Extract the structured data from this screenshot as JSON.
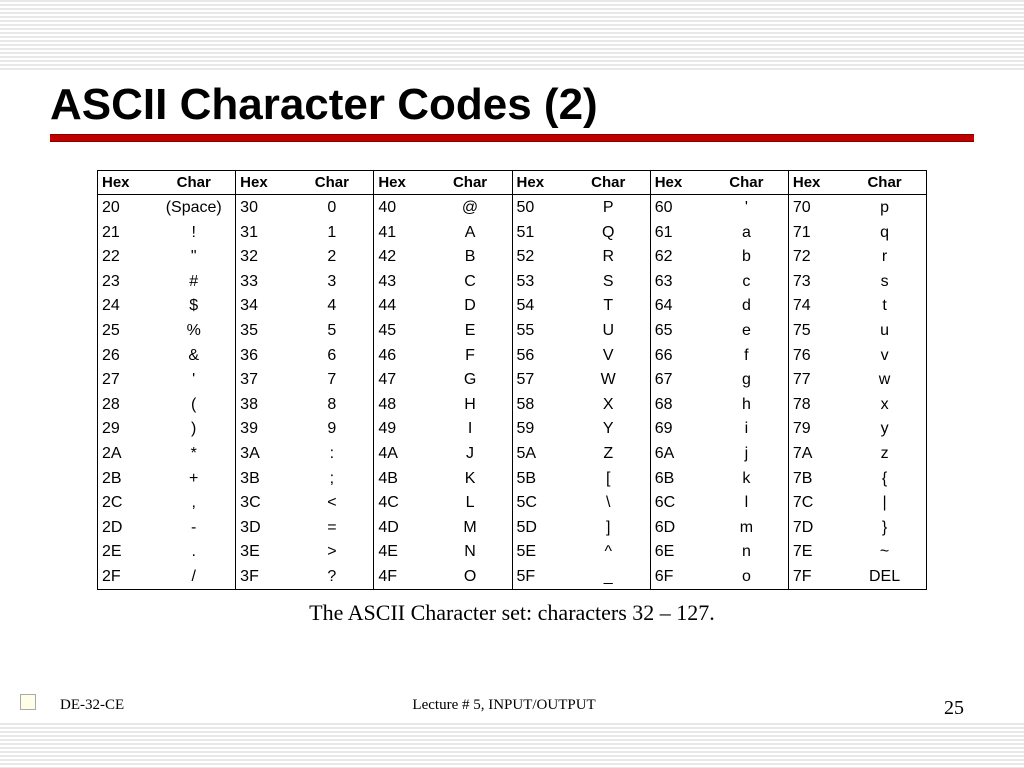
{
  "title": "ASCII Character Codes (2)",
  "headers": {
    "hex": "Hex",
    "char": "Char"
  },
  "columns": [
    [
      {
        "hex": "20",
        "char": "(Space)"
      },
      {
        "hex": "21",
        "char": "!"
      },
      {
        "hex": "22",
        "char": "\""
      },
      {
        "hex": "23",
        "char": "#"
      },
      {
        "hex": "24",
        "char": "$"
      },
      {
        "hex": "25",
        "char": "%"
      },
      {
        "hex": "26",
        "char": "&"
      },
      {
        "hex": "27",
        "char": "'"
      },
      {
        "hex": "28",
        "char": "("
      },
      {
        "hex": "29",
        "char": ")"
      },
      {
        "hex": "2A",
        "char": "*"
      },
      {
        "hex": "2B",
        "char": "+"
      },
      {
        "hex": "2C",
        "char": ","
      },
      {
        "hex": "2D",
        "char": "-"
      },
      {
        "hex": "2E",
        "char": "."
      },
      {
        "hex": "2F",
        "char": "/"
      }
    ],
    [
      {
        "hex": "30",
        "char": "0"
      },
      {
        "hex": "31",
        "char": "1"
      },
      {
        "hex": "32",
        "char": "2"
      },
      {
        "hex": "33",
        "char": "3"
      },
      {
        "hex": "34",
        "char": "4"
      },
      {
        "hex": "35",
        "char": "5"
      },
      {
        "hex": "36",
        "char": "6"
      },
      {
        "hex": "37",
        "char": "7"
      },
      {
        "hex": "38",
        "char": "8"
      },
      {
        "hex": "39",
        "char": "9"
      },
      {
        "hex": "3A",
        "char": ":"
      },
      {
        "hex": "3B",
        "char": ";"
      },
      {
        "hex": "3C",
        "char": "<"
      },
      {
        "hex": "3D",
        "char": "="
      },
      {
        "hex": "3E",
        "char": ">"
      },
      {
        "hex": "3F",
        "char": "?"
      }
    ],
    [
      {
        "hex": "40",
        "char": "@"
      },
      {
        "hex": "41",
        "char": "A"
      },
      {
        "hex": "42",
        "char": "B"
      },
      {
        "hex": "43",
        "char": "C"
      },
      {
        "hex": "44",
        "char": "D"
      },
      {
        "hex": "45",
        "char": "E"
      },
      {
        "hex": "46",
        "char": "F"
      },
      {
        "hex": "47",
        "char": "G"
      },
      {
        "hex": "48",
        "char": "H"
      },
      {
        "hex": "49",
        "char": "I"
      },
      {
        "hex": "4A",
        "char": "J"
      },
      {
        "hex": "4B",
        "char": "K"
      },
      {
        "hex": "4C",
        "char": "L"
      },
      {
        "hex": "4D",
        "char": "M"
      },
      {
        "hex": "4E",
        "char": "N"
      },
      {
        "hex": "4F",
        "char": "O"
      }
    ],
    [
      {
        "hex": "50",
        "char": "P"
      },
      {
        "hex": "51",
        "char": "Q"
      },
      {
        "hex": "52",
        "char": "R"
      },
      {
        "hex": "53",
        "char": "S"
      },
      {
        "hex": "54",
        "char": "T"
      },
      {
        "hex": "55",
        "char": "U"
      },
      {
        "hex": "56",
        "char": "V"
      },
      {
        "hex": "57",
        "char": "W"
      },
      {
        "hex": "58",
        "char": "X"
      },
      {
        "hex": "59",
        "char": "Y"
      },
      {
        "hex": "5A",
        "char": "Z"
      },
      {
        "hex": "5B",
        "char": "["
      },
      {
        "hex": "5C",
        "char": "\\"
      },
      {
        "hex": "5D",
        "char": "]"
      },
      {
        "hex": "5E",
        "char": "^"
      },
      {
        "hex": "5F",
        "char": "_"
      }
    ],
    [
      {
        "hex": "60",
        "char": "'"
      },
      {
        "hex": "61",
        "char": "a"
      },
      {
        "hex": "62",
        "char": "b"
      },
      {
        "hex": "63",
        "char": "c"
      },
      {
        "hex": "64",
        "char": "d"
      },
      {
        "hex": "65",
        "char": "e"
      },
      {
        "hex": "66",
        "char": "f"
      },
      {
        "hex": "67",
        "char": "g"
      },
      {
        "hex": "68",
        "char": "h"
      },
      {
        "hex": "69",
        "char": "i"
      },
      {
        "hex": "6A",
        "char": "j"
      },
      {
        "hex": "6B",
        "char": "k"
      },
      {
        "hex": "6C",
        "char": "l"
      },
      {
        "hex": "6D",
        "char": "m"
      },
      {
        "hex": "6E",
        "char": "n"
      },
      {
        "hex": "6F",
        "char": "o"
      }
    ],
    [
      {
        "hex": "70",
        "char": "p"
      },
      {
        "hex": "71",
        "char": "q"
      },
      {
        "hex": "72",
        "char": "r"
      },
      {
        "hex": "73",
        "char": "s"
      },
      {
        "hex": "74",
        "char": "t"
      },
      {
        "hex": "75",
        "char": "u"
      },
      {
        "hex": "76",
        "char": "v"
      },
      {
        "hex": "77",
        "char": "w"
      },
      {
        "hex": "78",
        "char": "x"
      },
      {
        "hex": "79",
        "char": "y"
      },
      {
        "hex": "7A",
        "char": "z"
      },
      {
        "hex": "7B",
        "char": "{"
      },
      {
        "hex": "7C",
        "char": "|"
      },
      {
        "hex": "7D",
        "char": "}"
      },
      {
        "hex": "7E",
        "char": "~"
      },
      {
        "hex": "7F",
        "char": "DEL"
      }
    ]
  ],
  "caption": "The ASCII Character set: characters 32 – 127.",
  "footer": {
    "left": "DE-32-CE",
    "center": "Lecture # 5, INPUT/OUTPUT",
    "page": "25"
  }
}
